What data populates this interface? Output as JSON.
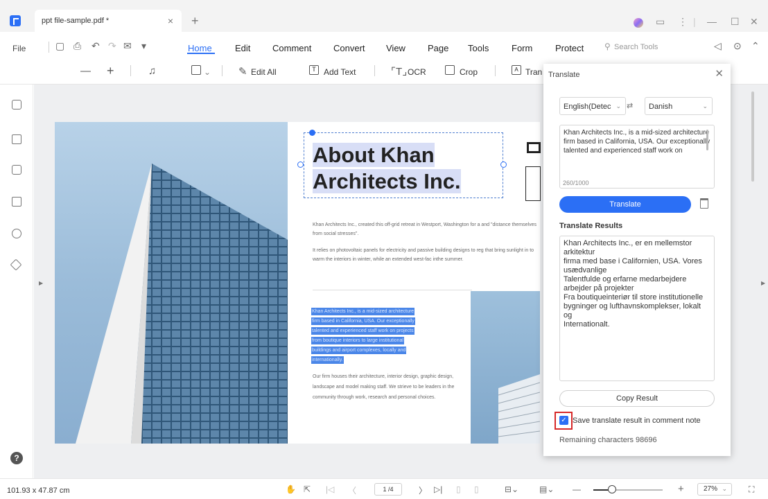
{
  "tab": {
    "title": "ppt file-sample.pdf *",
    "close": "×",
    "add": "+"
  },
  "window": {
    "minimize": "—",
    "maximize": "☐",
    "close": "✕"
  },
  "menu": {
    "file": "File",
    "items": [
      "Home",
      "Edit",
      "Comment",
      "Convert",
      "View",
      "Page",
      "Tools",
      "Form",
      "Protect"
    ],
    "search_placeholder": "Search Tools"
  },
  "toolbar": {
    "edit_all": "Edit All",
    "add_text": "Add Text",
    "ocr": "OCR",
    "crop": "Crop",
    "translate": "Tran"
  },
  "document": {
    "heading_line1": "About Khan",
    "heading_line2": "Architects Inc.",
    "para1": "Khan Architects Inc., created this off-grid retreat in Westport, Washington for a and \"distance themselves from social stresses\".",
    "para2": "It relies on photovoltaic panels for electricity and passive building designs to reg that bring sunlight in to warm the interiors in winter, while an extended west-fac inthe summer.",
    "highlighted_lines": [
      "Khan Architects Inc., is a mid-sized architecture",
      "firm based in California, USA. Our exceptionally",
      "talented and experienced staff work on projects",
      "from boutique interiors to large institutional",
      "buildings and airport complexes, locally and",
      "internationally."
    ],
    "body_rest": "Our firm houses their architecture, interior design, graphic design, landscape and model making staff. We strieve to be leaders in the community through work, research and personal choices."
  },
  "translate_panel": {
    "title": "Translate",
    "source_lang": "English(Detec",
    "target_lang": "Danish",
    "source_text": "Khan Architects Inc., is a mid-sized architecture\nfirm based in California, USA. Our exceptionally\ntalented and experienced staff work on",
    "counter": "260/1000",
    "translate_button": "Translate",
    "results_label": "Translate Results",
    "result_text": "Khan Architects Inc., er en mellemstor arkitektur\nfirma med base i Californien, USA. Vores usædvanlige\nTalentfulde og erfarne medarbejdere arbejder på projekter\nFra boutiqueinteriør til store institutionelle\nbygninger og lufthavnskomplekser, lokalt og\nInternationalt.",
    "copy_button": "Copy Result",
    "save_checkbox_label": "Save translate result in comment note",
    "save_checked": true,
    "remaining": "Remaining characters 98696"
  },
  "status": {
    "dimensions": "101.93 x 47.87 cm",
    "page": "1 /4",
    "zoom": "27%",
    "zoom_level": 0.27
  },
  "colors": {
    "accent": "#2b6ff5",
    "highlight": "#4a86e8",
    "checkbox_outline": "#d62828"
  }
}
